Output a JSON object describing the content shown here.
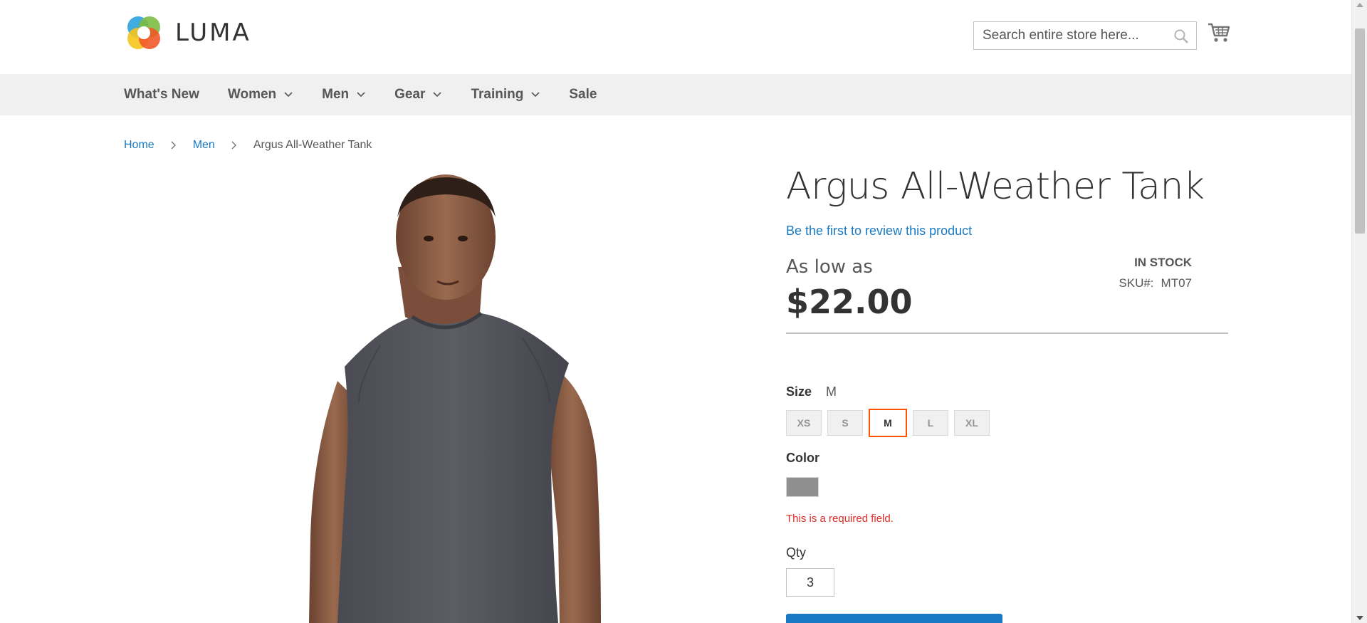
{
  "header": {
    "logo_text": "LUMA",
    "search_placeholder": "Search entire store here...",
    "search_icon": "search-icon",
    "cart_icon": "cart-icon"
  },
  "nav": {
    "items": [
      {
        "label": "What's New",
        "has_dropdown": false
      },
      {
        "label": "Women",
        "has_dropdown": true
      },
      {
        "label": "Men",
        "has_dropdown": true
      },
      {
        "label": "Gear",
        "has_dropdown": true
      },
      {
        "label": "Training",
        "has_dropdown": true
      },
      {
        "label": "Sale",
        "has_dropdown": false
      }
    ]
  },
  "breadcrumb": {
    "items": [
      "Home",
      "Men"
    ],
    "current": "Argus All-Weather Tank"
  },
  "product": {
    "title": "Argus All-Weather Tank",
    "review_link": "Be the first to review this product",
    "price_prefix": "As low as",
    "price": "$22.00",
    "stock": "IN STOCK",
    "sku_label": "SKU#:",
    "sku": "MT07",
    "size_label": "Size",
    "size_selected": "M",
    "sizes": [
      "XS",
      "S",
      "M",
      "L",
      "XL"
    ],
    "color_label": "Color",
    "color_swatch": "#8f8f8f",
    "required_message": "This is a required field.",
    "qty_label": "Qty",
    "qty_value": "3"
  },
  "colors": {
    "link": "#1979c3",
    "nav_bg": "#f0f0f0",
    "active_swatch_border": "#ff5501",
    "error": "#e02b27",
    "primary_button": "#1979c3"
  }
}
